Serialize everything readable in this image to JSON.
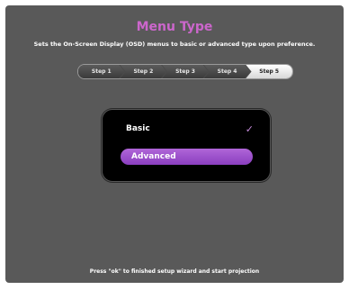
{
  "header": {
    "title": "Menu Type",
    "subtitle": "Sets the On-Screen Display (OSD) menus to basic or advanced type upon preference."
  },
  "steps": [
    {
      "label": "Step 1",
      "active": false
    },
    {
      "label": "Step 2",
      "active": false
    },
    {
      "label": "Step 3",
      "active": false
    },
    {
      "label": "Step 4",
      "active": false
    },
    {
      "label": "Step 5",
      "active": true
    }
  ],
  "menu": {
    "options": [
      {
        "label": "Basic",
        "selected": false,
        "checked": true
      },
      {
        "label": "Advanced",
        "selected": true,
        "checked": false
      }
    ],
    "check_glyph": "✓"
  },
  "footer": {
    "text": "Press \"ok\" to finished setup wizard and start projection"
  },
  "colors": {
    "background": "#595959",
    "title": "#cc66cc",
    "highlight": "#9b4fcc",
    "panel": "#000000"
  }
}
